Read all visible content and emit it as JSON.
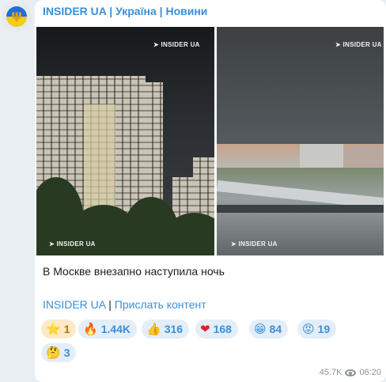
{
  "channel": {
    "title": "INSIDER UA | Україна | Новини",
    "avatar_icon": "ukraine-trident-icon"
  },
  "photos": [
    {
      "watermark": "INSIDER UA",
      "watermark_bottom": "INSIDER UA"
    },
    {
      "watermark": "INSIDER UA",
      "watermark_bottom": "INSIDER UA"
    }
  ],
  "message": {
    "text": "В Москве внезапно наступила ночь",
    "link1": "INSIDER UA",
    "separator": "|",
    "link2": "Прислать контент"
  },
  "reactions": [
    {
      "emoji": "⭐",
      "icon": "star-icon",
      "count": "1"
    },
    {
      "emoji": "🔥",
      "icon": "fire-icon",
      "count": "1.44K"
    },
    {
      "emoji": "👍",
      "icon": "thumbs-up-icon",
      "count": "316"
    },
    {
      "emoji": "❤",
      "icon": "heart-icon",
      "count": "168"
    },
    {
      "emoji": "😁",
      "icon": "grin-icon",
      "count": "84"
    },
    {
      "emoji": "😡",
      "icon": "angry-icon",
      "count": "19"
    },
    {
      "emoji": "🤔",
      "icon": "thinking-icon",
      "count": "3"
    }
  ],
  "meta": {
    "views": "45.7K",
    "time": "06:20"
  }
}
